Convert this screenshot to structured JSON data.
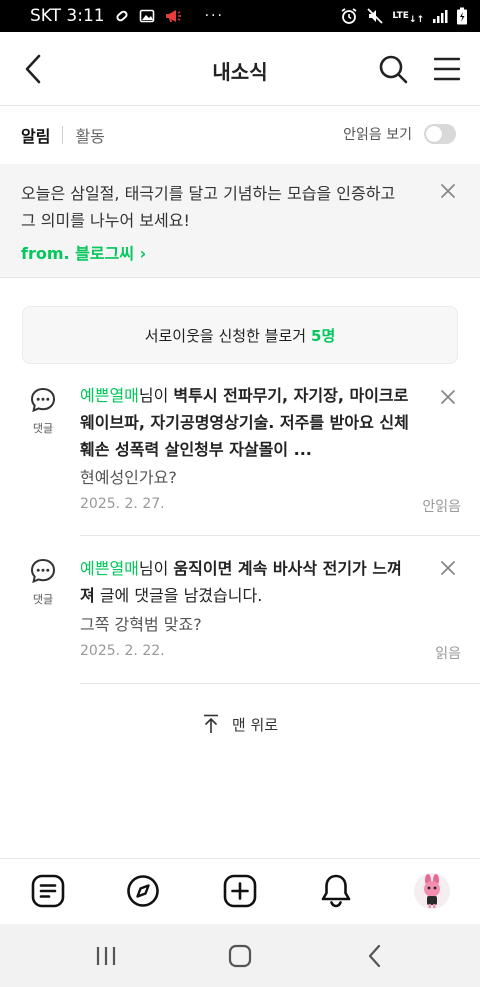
{
  "status_bar": {
    "carrier_time": "SKT 3:11",
    "more": "···",
    "network": "LTE",
    "icons": [
      "link-icon",
      "image-icon",
      "megaphone-icon",
      "alarm-icon",
      "mute-icon",
      "signal-icon",
      "battery-icon"
    ]
  },
  "header": {
    "title": "내소식"
  },
  "tabs": {
    "items": [
      "알림",
      "활동"
    ],
    "unread_label": "안읽음 보기"
  },
  "banner": {
    "text": "오늘은 삼일절, 태극기를 달고 기념하는 모습을 인증하고 그 의미를 나누어 보세요!",
    "from": "from. 블로그씨 ›"
  },
  "neighbor_request": {
    "text": "서로이웃을 신청한 블로거",
    "count": "5명"
  },
  "notifications": [
    {
      "icon_label": "댓글",
      "user": "예쁜열매",
      "particle": "님이 ",
      "post": "벽투시 전파무기, 자기장, 마이크로웨이브파, 자기공명영상기술. 저주를 받아요 신체훼손 성폭력 살인청부 자살몰이 ...",
      "suffix": "",
      "comment": "현예성인가요?",
      "date": "2025. 2. 27.",
      "read_state": "안읽음"
    },
    {
      "icon_label": "댓글",
      "user": "예쁜열매",
      "particle": "님이 ",
      "post": "움직이면 계속 바사삭 전기가 느껴져",
      "suffix": " 글에 댓글을 남겼습니다.",
      "comment": "그쪽 강혁범 맞죠?",
      "date": "2025. 2. 22.",
      "read_state": "읽음"
    }
  ],
  "scroll_top": {
    "label": "맨 위로"
  },
  "bottom_tabs": [
    "feed-icon",
    "discover-icon",
    "write-icon",
    "notification-bell-icon",
    "profile-avatar"
  ],
  "colors": {
    "accent_green": "#03c75a",
    "banner_bg": "#f5f5f5"
  }
}
